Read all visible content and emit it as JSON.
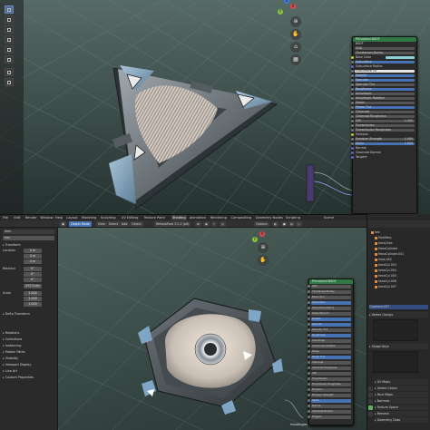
{
  "top": {
    "node": {
      "title": "Principled BSDF",
      "subtitle": "BSDF",
      "rows": [
        {
          "label": "GGX",
          "kind": "field"
        },
        {
          "label": "Christensen-Burley",
          "kind": "field"
        },
        {
          "label": "Base Color",
          "kind": "swatch",
          "sock": "y"
        },
        {
          "label": "Subsurface",
          "kind": "bar",
          "sel": true
        },
        {
          "label": "Subsurface Radius",
          "kind": "plain",
          "sock": "p"
        },
        {
          "label": "Subsurface Co",
          "kind": "wht"
        },
        {
          "label": "Metallic",
          "kind": "bar",
          "sel": true
        },
        {
          "label": "Specular",
          "kind": "bar",
          "sel": true
        },
        {
          "label": "Specular Tint",
          "kind": "bar"
        },
        {
          "label": "Roughness",
          "kind": "bar",
          "sel": true
        },
        {
          "label": "Anisotropic",
          "kind": "bar"
        },
        {
          "label": "Anisotropic Rotation",
          "kind": "bar"
        },
        {
          "label": "Sheen",
          "kind": "bar"
        },
        {
          "label": "Sheen Tint",
          "kind": "bar",
          "sel": true
        },
        {
          "label": "Clearcoat",
          "kind": "bar"
        },
        {
          "label": "Clearcoat Roughness",
          "kind": "bar"
        },
        {
          "label": "IOR",
          "kind": "bar",
          "val": "1.450"
        },
        {
          "label": "Transmission",
          "kind": "bar"
        },
        {
          "label": "Transmission Roughness",
          "kind": "bar"
        },
        {
          "label": "Emission",
          "kind": "plain",
          "sock": "y"
        },
        {
          "label": "Emission Strength",
          "kind": "bar",
          "val": "1.000"
        },
        {
          "label": "Alpha",
          "kind": "bar",
          "sel": true,
          "val": "1.000"
        },
        {
          "label": "Normal",
          "kind": "plain",
          "sock": "p"
        },
        {
          "label": "Clearcoat Normal",
          "kind": "plain",
          "sock": "p"
        },
        {
          "label": "Tangent",
          "kind": "plain",
          "sock": "p"
        }
      ]
    },
    "axes": {
      "x": "X",
      "y": "Y",
      "z": "Z"
    }
  },
  "menubar": {
    "items": [
      "File",
      "Edit",
      "Render",
      "Window",
      "Help",
      "Layout",
      "Modeling",
      "Sculpting",
      "UV Editing",
      "Texture Paint",
      "Shading",
      "Animation",
      "Rendering",
      "Compositing",
      "Geometry Nodes",
      "Scripting"
    ],
    "active": "Shading",
    "scene_label": "Scene",
    "view_layer_label": "View Layer"
  },
  "header2": {
    "mode": "Object Mode",
    "menus": [
      "View",
      "Select",
      "Add",
      "Object"
    ],
    "addon": "RetopoFlow 3.2.2 (alt)",
    "options": "Options"
  },
  "npanel": {
    "item_title": "Item",
    "object_name": "hex",
    "sections": [
      "Transform",
      "Delta Transform",
      "Relations",
      "Collections",
      "Instancing",
      "Motion Paths",
      "Visibility",
      "Viewport Display",
      "Line Art",
      "Custom Properties"
    ],
    "location_label": "Location",
    "rotation_label": "Rotation",
    "rotation_mode": "XYZ Euler",
    "scale_label": "Scale",
    "loc": [
      "0 m",
      "0 m",
      "0 m"
    ],
    "rot": [
      "0°",
      "0°",
      "0°"
    ],
    "scale": [
      "1.000",
      "1.000",
      "1.000"
    ],
    "axis_labels": [
      "X",
      "Y",
      "Z"
    ],
    "mode": "W"
  },
  "bottom_node": {
    "title": "Principled BSDF",
    "rows": [
      "GGX",
      "Christensen-Burley",
      "Base Color",
      "Subsurface",
      "Subsurface Radius",
      "Subsurface Co",
      "Metallic",
      "Specular",
      "Specular Tint",
      "Roughness",
      "Anisotropic",
      "Anisotropic Rotation",
      "Sheen",
      "Sheen Tint",
      "Clearcoat",
      "Clearcoat Roughness",
      "IOR",
      "Transmission",
      "Transmission Roughness",
      "Emission",
      "Emission Strength",
      "Alpha",
      "Normal",
      "Clearcoat Normal",
      "Tangent"
    ],
    "footer": "hexaAngles"
  },
  "outliner": {
    "items": [
      {
        "label": "hex",
        "sel": false
      },
      {
        "label": "Modifiers",
        "sel": false
      },
      {
        "label": "hexa2hex",
        "sel": false
      },
      {
        "label": "HexaCylinder",
        "sel": false
      },
      {
        "label": "HexaCylinder.001",
        "sel": false
      },
      {
        "label": "hexa.002",
        "sel": false
      },
      {
        "label": "hexaCyl.003",
        "sel": false
      },
      {
        "label": "hexaCyl.004",
        "sel": false
      },
      {
        "label": "hexaCyl.005",
        "sel": false
      },
      {
        "label": "hexaCyl.006",
        "sel": false
      },
      {
        "label": "hexaCyl.007",
        "sel": false
      }
    ],
    "selected_name": "Cueplane.007",
    "sections_top": [
      "Vertex Groups",
      "Shape Keys"
    ],
    "sections_bottom": [
      "UV Maps",
      "Vertex Colors",
      "Face Maps",
      "Normals",
      "Texture Space",
      "Remesh",
      "Geometry Data"
    ]
  }
}
